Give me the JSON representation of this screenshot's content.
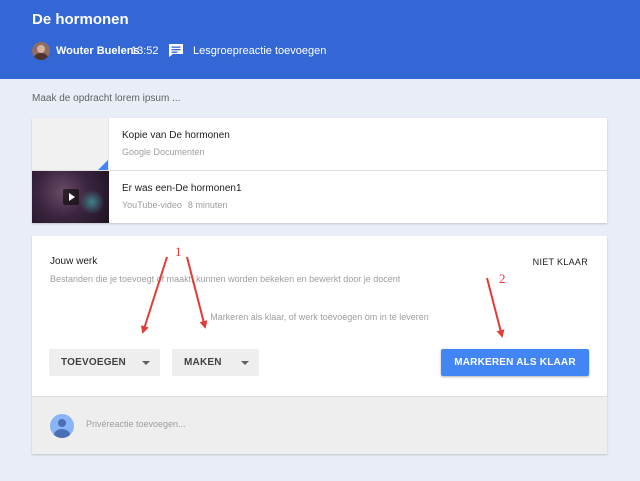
{
  "header": {
    "title": "De hormonen",
    "author": "Wouter Buelens",
    "time": "13:52",
    "comment_link": "Lesgroepreactie toevoegen"
  },
  "instructions": "Maak de opdracht lorem ipsum ...",
  "materials": [
    {
      "title": "Kopie van De hormonen",
      "subtitle": "Google Documenten",
      "icon": "google-docs-icon"
    },
    {
      "title": "Er was een-De hormonen1",
      "subtitle": "YouTube-video",
      "duration": "8 minuten",
      "icon": "play-icon"
    }
  ],
  "work": {
    "title": "Jouw werk",
    "status": "NIET KLAAR",
    "description": "Bestanden die je toevoegt of maakt, kunnen worden bekeken en bewerkt door je docent",
    "hint": "Markeren als klaar, of werk toevoegen om in te leveren",
    "add_button": "TOEVOEGEN",
    "make_button": "MAKEN",
    "mark_button": "MARKEREN ALS KLAAR",
    "private_placeholder": "Privéreactie toevoegen..."
  },
  "annotations": {
    "label_1": "1",
    "label_2": "2",
    "color": "#e53935"
  },
  "colors": {
    "header": "#3367d6",
    "primary_button": "#4285f4",
    "background": "#e9edf5"
  }
}
